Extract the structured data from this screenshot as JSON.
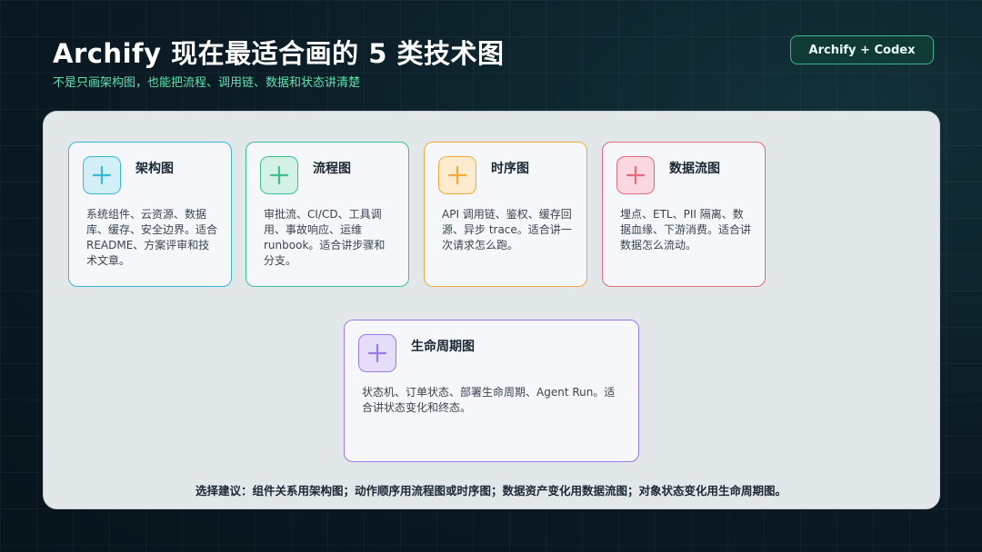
{
  "header": {
    "title": "Archify 现在最适合画的 5 类技术图",
    "subtitle": "不是只画架构图，也能把流程、调用链、数据和状态讲清楚",
    "badge": "Archify + Codex"
  },
  "cards": [
    {
      "title": "架构图",
      "desc": "系统组件、云资源、数据库、缓存、安全边界。适合 README、方案评审和技术文章。",
      "color": "#36b9d6",
      "icon_bg": "#d2eef6",
      "icon": "plus-icon"
    },
    {
      "title": "流程图",
      "desc": "审批流、CI/CD、工具调用、事故响应、运维 runbook。适合讲步骤和分支。",
      "color": "#3fbf8f",
      "icon_bg": "#d3f1e4",
      "icon": "plus-icon"
    },
    {
      "title": "时序图",
      "desc": "API 调用链、鉴权、缓存回源、异步 trace。适合讲一次请求怎么跑。",
      "color": "#f0a93a",
      "icon_bg": "#fcebcf",
      "icon": "plus-icon"
    },
    {
      "title": "数据流图",
      "desc": "埋点、ETL、PII 隔离、数据血缘、下游消费。适合讲数据怎么流动。",
      "color": "#e46a7f",
      "icon_bg": "#f9d9df",
      "icon": "plus-icon"
    },
    {
      "title": "生命周期图",
      "desc": "状态机、订单状态、部署生命周期、Agent Run。适合讲状态变化和终态。",
      "color": "#9b7ae6",
      "icon_bg": "#e6ddf9",
      "icon": "plus-icon"
    }
  ],
  "footer_note": "选择建议：组件关系用架构图；动作顺序用流程图或时序图；数据资产变化用数据流图；对象状态变化用生命周期图。"
}
